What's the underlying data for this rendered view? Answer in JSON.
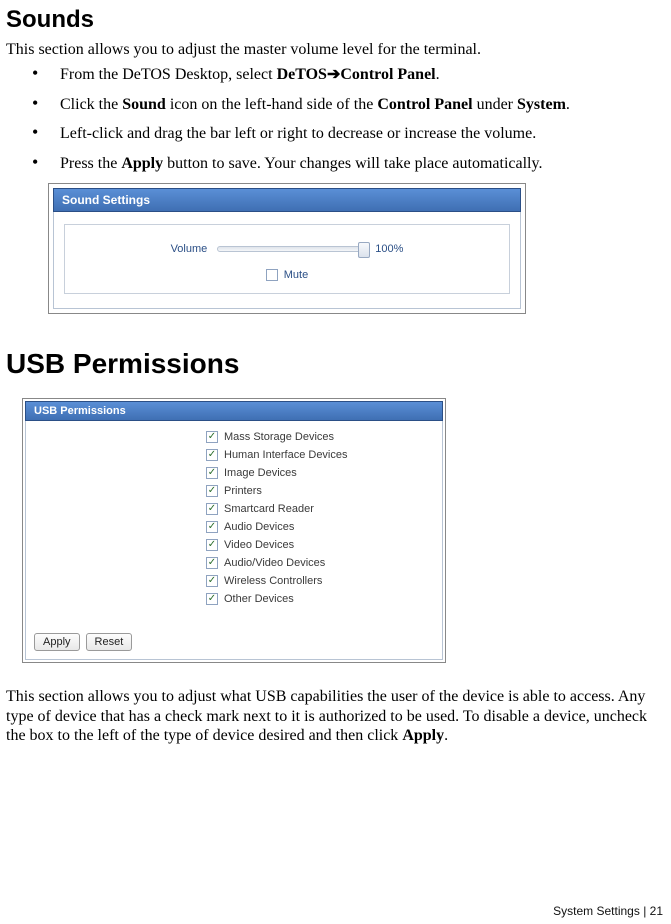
{
  "sounds": {
    "heading": "Sounds",
    "intro": "This section allows you to adjust the master volume level for the terminal.",
    "bullets": [
      {
        "pre": "From the DeTOS Desktop, select ",
        "b1": "DeTOS",
        "arrow": "➔",
        "b2": "Control Panel",
        "post": "."
      },
      {
        "pre": "Click the ",
        "b1": "Sound",
        "mid": " icon on the left-hand side of the ",
        "b2": "Control Panel",
        "post2": " under ",
        "b3": "System",
        "post": "."
      },
      {
        "text": "Left-click and drag the bar left or right to decrease or increase the volume."
      },
      {
        "pre": "Press the ",
        "b1": "Apply",
        "post": " button to save.  Your changes will take place automatically."
      }
    ],
    "panel": {
      "title": "Sound Settings",
      "volume_label": "Volume",
      "volume_value": "100%",
      "mute_label": "Mute",
      "mute_checked": false
    }
  },
  "usb": {
    "heading": "USB Permissions",
    "panel_title": "USB Permissions",
    "devices": [
      {
        "label": "Mass Storage Devices",
        "checked": true
      },
      {
        "label": "Human Interface Devices",
        "checked": true
      },
      {
        "label": "Image Devices",
        "checked": true
      },
      {
        "label": "Printers",
        "checked": true
      },
      {
        "label": "Smartcard Reader",
        "checked": true
      },
      {
        "label": "Audio Devices",
        "checked": true
      },
      {
        "label": "Video Devices",
        "checked": true
      },
      {
        "label": "Audio/Video Devices",
        "checked": true
      },
      {
        "label": "Wireless Controllers",
        "checked": true
      },
      {
        "label": "Other Devices",
        "checked": true
      }
    ],
    "buttons": {
      "apply": "Apply",
      "reset": "Reset"
    },
    "para_parts": {
      "pre": "This section allows you to adjust what USB capabilities the user of the device is able to access.  Any type of device that has a check mark next to it is authorized to be used.  To disable a device, uncheck the box to the left of the type of device desired and then click ",
      "b": "Apply",
      "post": "."
    }
  },
  "footer": {
    "text": "System Settings | 21"
  }
}
